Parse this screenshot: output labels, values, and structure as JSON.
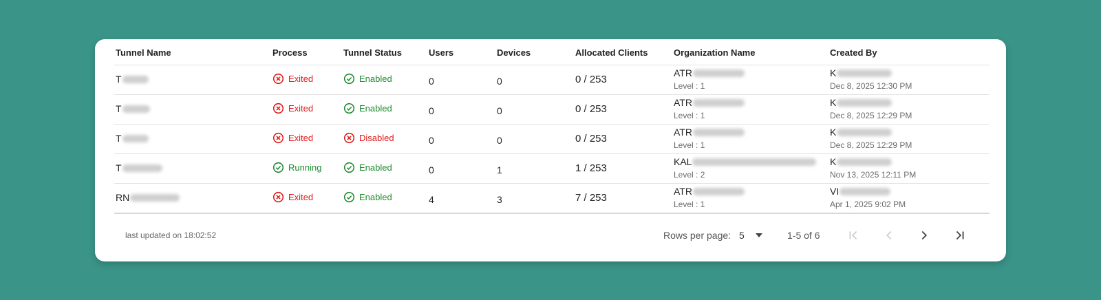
{
  "table": {
    "headers": [
      "Tunnel Name",
      "Process",
      "Tunnel Status",
      "Users",
      "Devices",
      "Allocated Clients",
      "Organization Name",
      "Created By"
    ],
    "rows": [
      {
        "name": "T",
        "process": "Exited",
        "status": "Enabled",
        "users": "0",
        "devices": "0",
        "allocated": "0 / 253",
        "org": "ATR",
        "level": "Level : 1",
        "created_by": "K",
        "created_at": "Dec 8, 2025 12:30 PM"
      },
      {
        "name": "T",
        "process": "Exited",
        "status": "Enabled",
        "users": "0",
        "devices": "0",
        "allocated": "0 / 253",
        "org": "ATR",
        "level": "Level : 1",
        "created_by": "K",
        "created_at": "Dec 8, 2025 12:29 PM"
      },
      {
        "name": "T",
        "process": "Exited",
        "status": "Disabled",
        "users": "0",
        "devices": "0",
        "allocated": "0 / 253",
        "org": "ATR",
        "level": "Level : 1",
        "created_by": "K",
        "created_at": "Dec 8, 2025 12:29 PM"
      },
      {
        "name": "T",
        "process": "Running",
        "status": "Enabled",
        "users": "0",
        "devices": "1",
        "allocated": "1 / 253",
        "org": "KAL",
        "level": "Level : 2",
        "created_by": "K",
        "created_at": "Nov 13, 2025 12:11 PM"
      },
      {
        "name": "RN",
        "process": "Exited",
        "status": "Enabled",
        "users": "4",
        "devices": "3",
        "allocated": "7 / 253",
        "org": "ATR",
        "level": "Level : 1",
        "created_by": "VI",
        "created_at": "Apr 1, 2025 9:02 PM"
      }
    ]
  },
  "footer": {
    "last_updated": "last updated on 18:02:52",
    "rows_per_page_label": "Rows per page:",
    "rows_per_page_value": "5",
    "range": "1-5 of 6"
  },
  "icons": {
    "exited": "x-circle-icon",
    "disabled": "x-circle-icon",
    "running": "check-circle-icon",
    "enabled": "check-circle-icon",
    "first_page": "first-page-icon",
    "prev_page": "chevron-left-icon",
    "next_page": "chevron-right-icon",
    "last_page": "last-page-icon"
  },
  "colors": {
    "background": "#3a9488",
    "error": "#e01919",
    "success": "#1e8a2e"
  }
}
